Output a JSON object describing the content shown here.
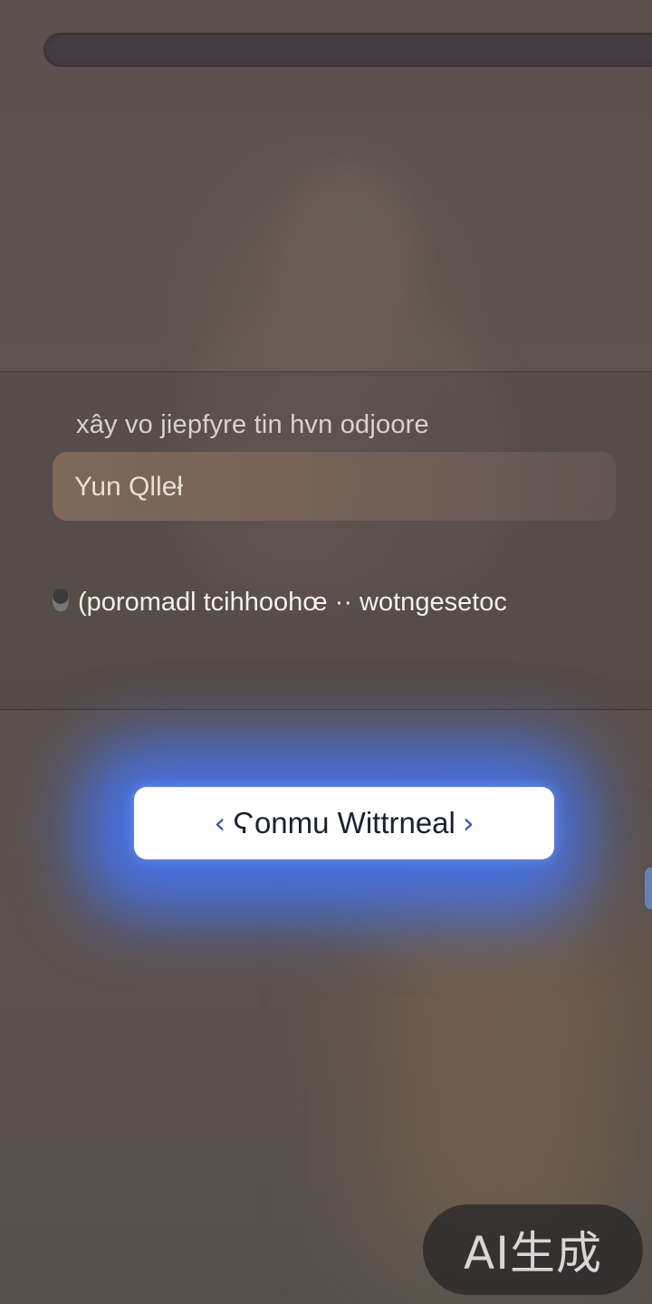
{
  "panel": {
    "title": "xây vo jiepfyre tin hvn odjoore",
    "name_field_value": "Yun Qlleł",
    "option_label": "(poromadl tcihhoohœ ·· wotngesetoc"
  },
  "primary_button": {
    "prefix_icon": "chevron-left-icon",
    "label": "Ϛonmu Wittrneal",
    "suffix_icon": "chevron-right-icon"
  },
  "watermark": {
    "text": "AI生成"
  },
  "colors": {
    "background": "#5a4f4b",
    "top_bar": "#443e43",
    "button_bg": "#ffffff",
    "button_glow": "#4278ff",
    "chevron": "#2d5aa6",
    "watermark_bg": "#282628"
  }
}
